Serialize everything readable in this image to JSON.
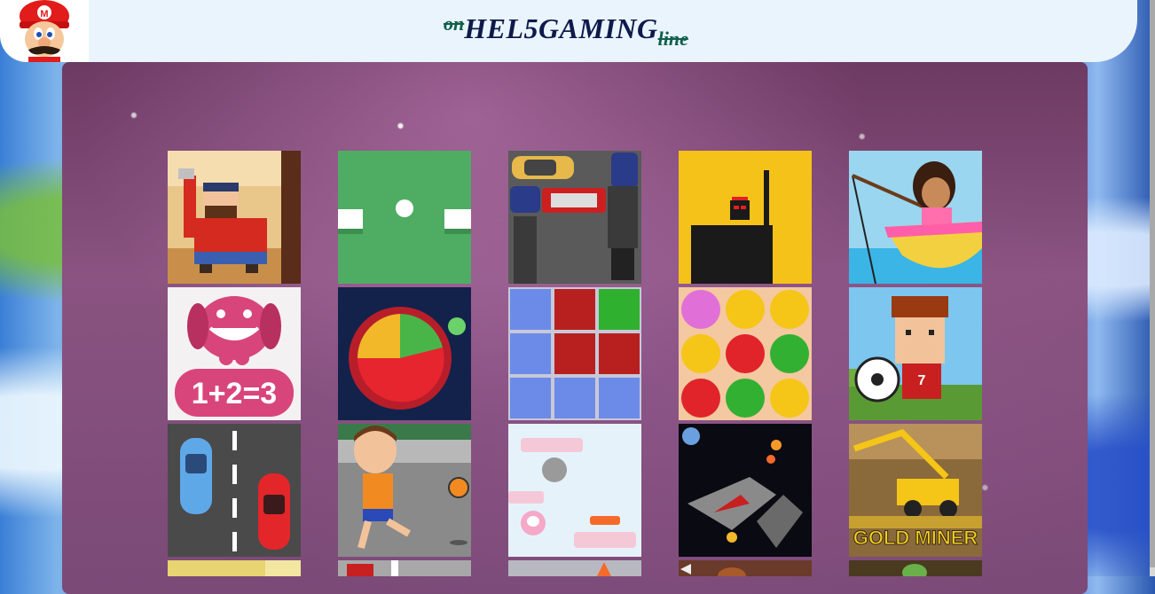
{
  "header": {
    "title_prefix": "on",
    "title_main": "HEL5GAMING",
    "title_suffix": "line",
    "logo_icon": "mario-avatar-icon"
  },
  "games": [
    {
      "row": 0,
      "col": 0,
      "icon": "lumberjack-game-thumbnail"
    },
    {
      "row": 0,
      "col": 1,
      "icon": "pong-game-thumbnail"
    },
    {
      "row": 0,
      "col": 2,
      "icon": "parking-cars-game-thumbnail"
    },
    {
      "row": 0,
      "col": 3,
      "icon": "stick-hero-game-thumbnail"
    },
    {
      "row": 0,
      "col": 4,
      "icon": "dora-fishing-game-thumbnail"
    },
    {
      "row": 1,
      "col": 0,
      "icon": "math-dog-game-thumbnail",
      "text": "1+2=3"
    },
    {
      "row": 1,
      "col": 1,
      "icon": "planet-defense-game-thumbnail"
    },
    {
      "row": 1,
      "col": 2,
      "icon": "match-blocks-game-thumbnail"
    },
    {
      "row": 1,
      "col": 3,
      "icon": "jelly-match-game-thumbnail"
    },
    {
      "row": 1,
      "col": 4,
      "icon": "pixel-soccer-game-thumbnail",
      "text": "7"
    },
    {
      "row": 2,
      "col": 0,
      "icon": "car-road-game-thumbnail"
    },
    {
      "row": 2,
      "col": 1,
      "icon": "boy-kick-ball-game-thumbnail"
    },
    {
      "row": 2,
      "col": 2,
      "icon": "jump-platform-game-thumbnail"
    },
    {
      "row": 2,
      "col": 3,
      "icon": "space-fighter-game-thumbnail"
    },
    {
      "row": 2,
      "col": 4,
      "icon": "gold-miner-game-thumbnail",
      "text": "GOLD MINER"
    },
    {
      "row": 3,
      "col": 0,
      "icon": "partial-thumbnail-1"
    },
    {
      "row": 3,
      "col": 1,
      "icon": "partial-thumbnail-2"
    },
    {
      "row": 3,
      "col": 2,
      "icon": "partial-thumbnail-3"
    },
    {
      "row": 3,
      "col": 3,
      "icon": "partial-thumbnail-4"
    },
    {
      "row": 3,
      "col": 4,
      "icon": "partial-thumbnail-5"
    }
  ],
  "colors": {
    "header_bg": "#eaf4fd",
    "title_color": "#0d1a4a",
    "accent_green": "#0f5f4c",
    "panel_bg": "#7b4a77"
  }
}
